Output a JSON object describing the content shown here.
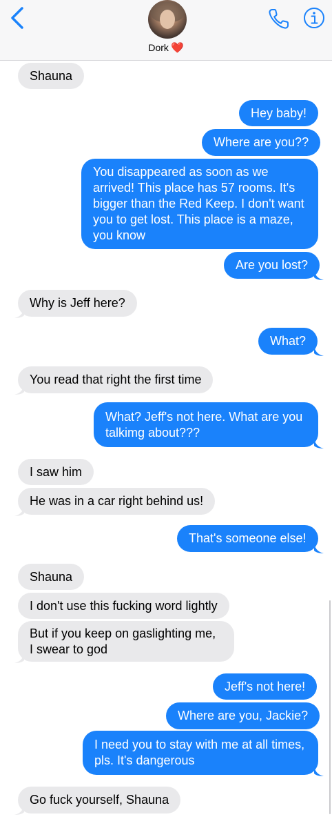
{
  "header": {
    "contact_name": "Dork",
    "contact_emoji": "❤️",
    "back_icon": "chevron-left-icon",
    "call_icon": "phone-icon",
    "info_icon": "info-icon"
  },
  "colors": {
    "outgoing_bubble": "#1a82fb",
    "incoming_bubble": "#e9e9eb",
    "accent": "#1a82fb"
  },
  "messages": [
    {
      "from": "them",
      "text": "Shauna"
    },
    {
      "from": "me",
      "text": "Hey baby!"
    },
    {
      "from": "me",
      "text": "Where are you??"
    },
    {
      "from": "me",
      "text": "You disappeared as soon as we arrived! This place has 57 rooms. It's bigger than the Red Keep. I don't want you to get lost. This place is a maze, you know"
    },
    {
      "from": "me",
      "text": "Are you lost?"
    },
    {
      "from": "them",
      "text": "Why is Jeff here?"
    },
    {
      "from": "me",
      "text": "What?"
    },
    {
      "from": "them",
      "text": "You read that right the first time"
    },
    {
      "from": "me",
      "text": "What? Jeff's not here. What are you talkimg about???"
    },
    {
      "from": "them",
      "text": "I saw him"
    },
    {
      "from": "them",
      "text": "He was in a car right behind us!"
    },
    {
      "from": "me",
      "text": "That's someone else!"
    },
    {
      "from": "them",
      "text": "Shauna"
    },
    {
      "from": "them",
      "text": "I don't use this fucking word lightly"
    },
    {
      "from": "them",
      "text": "But if you keep on gaslighting me, I swear to god"
    },
    {
      "from": "me",
      "text": "Jeff's not here!"
    },
    {
      "from": "me",
      "text": "Where are you, Jackie?"
    },
    {
      "from": "me",
      "text": "I need you to stay with me at all times, pls. It's dangerous"
    },
    {
      "from": "them",
      "text": "Go fuck yourself, Shauna"
    }
  ]
}
